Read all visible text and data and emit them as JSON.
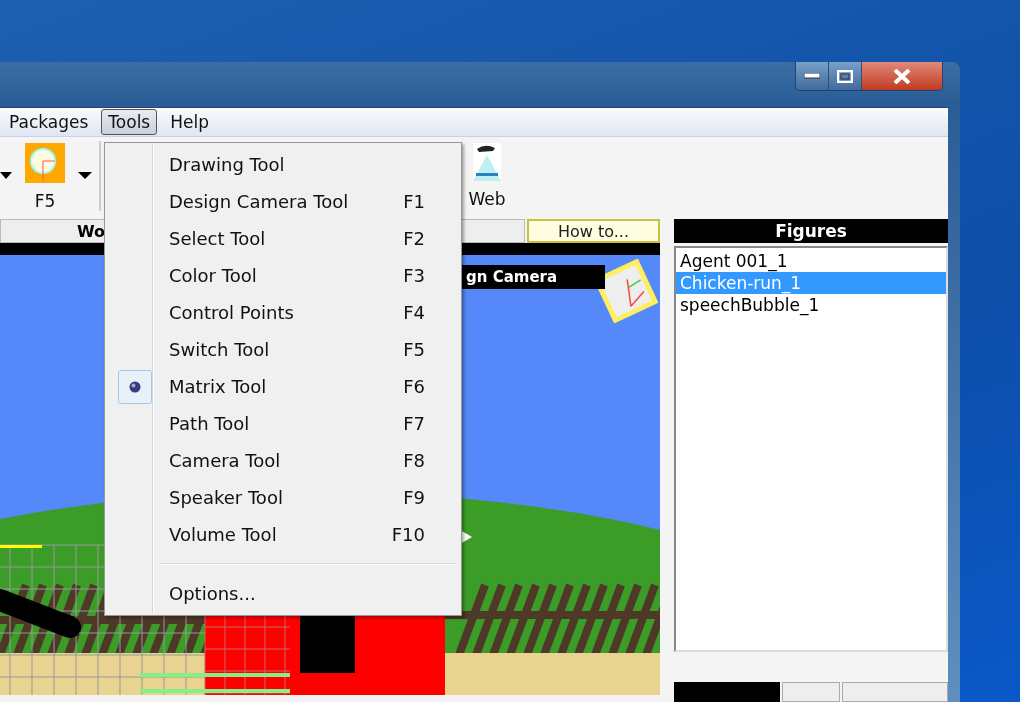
{
  "menu_bar": {
    "items": [
      {
        "label": "Packages",
        "selected": false
      },
      {
        "label": "Tools",
        "selected": true
      },
      {
        "label": "Help",
        "selected": false
      }
    ]
  },
  "toolbar": {
    "buttons": [
      {
        "kind": "bulb",
        "label": "F5"
      },
      {
        "kind": "web",
        "label": "Web"
      }
    ]
  },
  "workspace": {
    "header": "Wo",
    "help_button": "How to...",
    "camera_label": "gn Camera"
  },
  "tools_menu": {
    "items": [
      {
        "kind": "command",
        "label": "Drawing Tool",
        "checked": false
      },
      {
        "kind": "command",
        "label": "Design Camera Tool",
        "shortcut": "F1",
        "checked": false
      },
      {
        "kind": "command",
        "label": "Select Tool",
        "shortcut": "F2",
        "checked": false
      },
      {
        "kind": "command",
        "label": "Color Tool",
        "shortcut": "F3",
        "checked": false
      },
      {
        "kind": "command",
        "label": "Control Points",
        "shortcut": "F4",
        "checked": false
      },
      {
        "kind": "command",
        "label": "Switch Tool",
        "shortcut": "F5",
        "checked": false
      },
      {
        "kind": "command",
        "label": "Matrix Tool",
        "shortcut": "F6",
        "checked": true
      },
      {
        "kind": "command",
        "label": "Path Tool",
        "shortcut": "F7",
        "checked": false
      },
      {
        "kind": "command",
        "label": "Camera Tool",
        "shortcut": "F8",
        "checked": false
      },
      {
        "kind": "command",
        "label": "Speaker Tool",
        "shortcut": "F9",
        "checked": false
      },
      {
        "kind": "command",
        "label": "Volume Tool",
        "shortcut": "F10",
        "checked": false
      },
      {
        "kind": "separator"
      },
      {
        "kind": "command",
        "label": "Options...",
        "checked": false
      }
    ]
  },
  "figures": {
    "title": "Figures",
    "items": [
      {
        "label": "Agent 001_1",
        "selected": false
      },
      {
        "label": "Chicken-run_1",
        "selected": true
      },
      {
        "label": "speechBubble_1",
        "selected": false
      }
    ]
  }
}
